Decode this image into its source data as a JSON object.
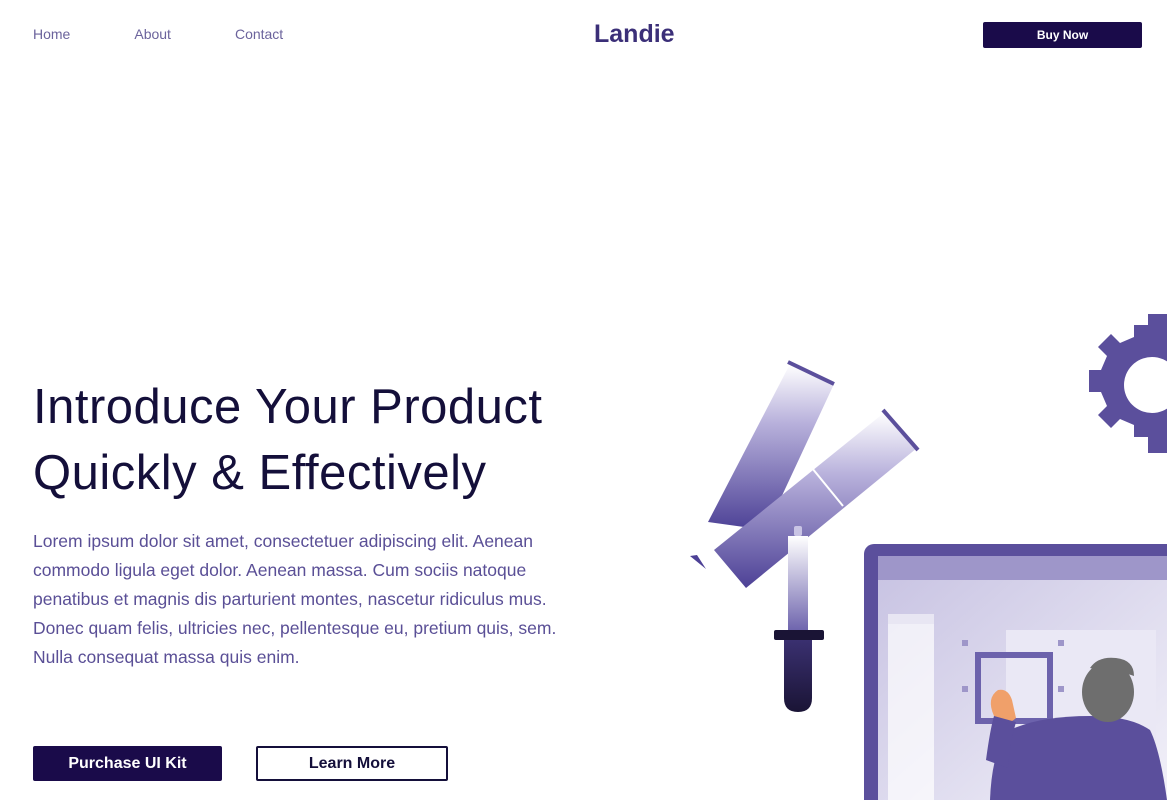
{
  "header": {
    "nav": [
      {
        "label": "Home"
      },
      {
        "label": "About"
      },
      {
        "label": "Contact"
      }
    ],
    "brand": "Landie",
    "cta_label": "Buy Now"
  },
  "hero": {
    "title_line1": "Introduce Your Product",
    "title_line2": "Quickly & Effectively",
    "body": "Lorem ipsum dolor sit amet, consectetuer adipiscing elit. Aenean commodo ligula eget dolor. Aenean massa. Cum sociis natoque penatibus et magnis dis parturient montes, nascetur ridiculus mus. Donec quam felis, ultricies nec, pellentesque eu, pretium quis, sem. Nulla consequat massa quis enim.",
    "primary_label": "Purchase UI Kit",
    "secondary_label": "Learn More"
  },
  "colors": {
    "brand": "#3b2f78",
    "dark": "#1a0b4a",
    "text": "#5a4f96",
    "accent": "#5b4f9c"
  },
  "illustration": {
    "icons": [
      "gear-icon",
      "paint-tube-icon",
      "eyedropper-icon",
      "monitor-icon",
      "designer-person"
    ]
  }
}
